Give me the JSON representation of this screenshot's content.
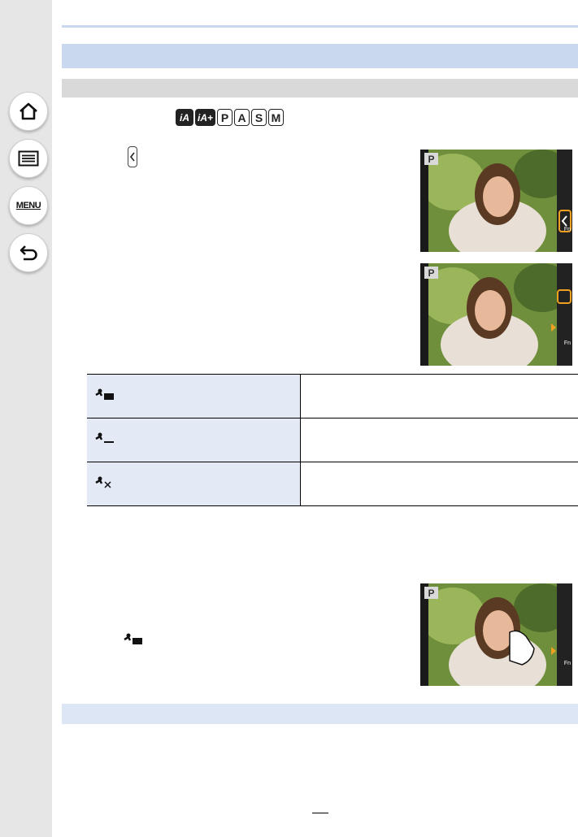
{
  "sidebar": {
    "items": [
      {
        "name": "home",
        "icon": "home-icon"
      },
      {
        "name": "contents",
        "icon": "list-icon"
      },
      {
        "name": "menu",
        "icon": "menu-icon",
        "label": "MENU"
      },
      {
        "name": "back",
        "icon": "back-arrow-icon"
      }
    ]
  },
  "modes": [
    "iA",
    "iA+",
    "P",
    "A",
    "S",
    "M"
  ],
  "camera_screens": [
    {
      "mode_label": "P"
    },
    {
      "mode_label": "P"
    },
    {
      "mode_label": "P"
    }
  ],
  "options": [
    {
      "icon": "touch-af-icon"
    },
    {
      "icon": "touch-ae-icon"
    },
    {
      "icon": "touch-off-icon"
    }
  ],
  "colors": {
    "header_band": "#c9d7ef",
    "sub_band": "#d9d9d9",
    "table_left": "#e4e9f6",
    "accent": "#f0a020"
  }
}
